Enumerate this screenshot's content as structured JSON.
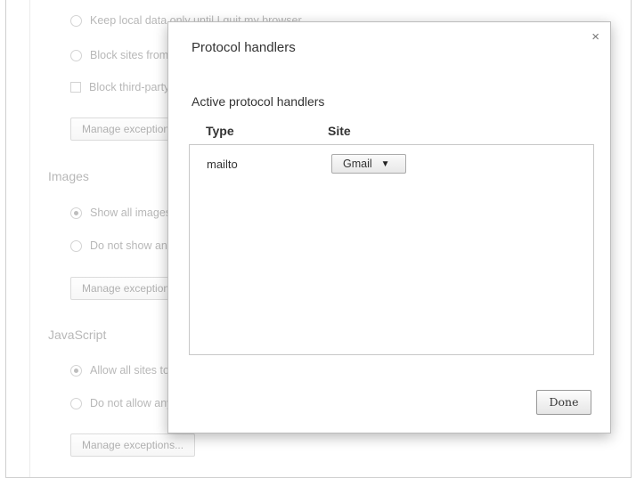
{
  "background": {
    "cookies": {
      "keep_local_label": "Keep local data only until I quit my browser",
      "block_sites_label": "Block sites from setting any data",
      "block_third_party_label": "Block third-party cookies and site data",
      "manage_exceptions_label": "Manage exceptions..."
    },
    "images": {
      "heading": "Images",
      "show_all_label": "Show all images (recommended)",
      "do_not_show_label": "Do not show any images",
      "manage_exceptions_label": "Manage exceptions..."
    },
    "javascript": {
      "heading": "JavaScript",
      "allow_all_label": "Allow all sites to run JavaScript (recommended)",
      "do_not_allow_label": "Do not allow any site to run JavaScript",
      "manage_exceptions_label": "Manage exceptions..."
    }
  },
  "dialog": {
    "title": "Protocol handlers",
    "close_label": "×",
    "section_title": "Active protocol handlers",
    "columns": {
      "type": "Type",
      "site": "Site"
    },
    "rows": [
      {
        "type": "mailto",
        "site": "Gmail"
      }
    ],
    "done_label": "Done"
  }
}
